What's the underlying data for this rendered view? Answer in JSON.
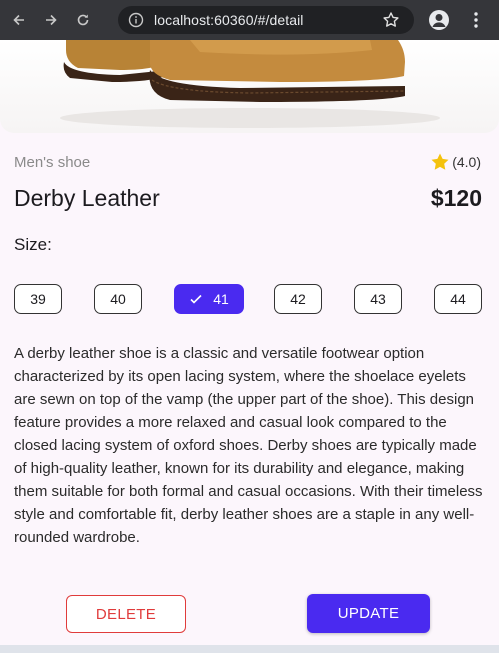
{
  "browser": {
    "url": "localhost:60360/#/detail",
    "icons": [
      "back-arrow-icon",
      "forward-arrow-icon",
      "reload-icon",
      "site-info-icon",
      "bookmark-star-icon",
      "profile-icon",
      "menu-dots-icon"
    ]
  },
  "product": {
    "category": "Men's shoe",
    "rating": "(4.0)",
    "name": "Derby Leather",
    "price": "$120",
    "size_label": "Size:",
    "sizes": [
      "39",
      "40",
      "41",
      "42",
      "43",
      "44"
    ],
    "selected_size": "41",
    "description": "A derby leather shoe is a classic and versatile footwear option characterized by its open lacing system, where the shoelace eyelets are sewn on top of the vamp (the upper part of the shoe). This design feature provides a more relaxed and casual look compared to the closed lacing system of oxford shoes. Derby shoes are typically made of high-quality leather, known for its durability and elegance, making them suitable for both formal and casual occasions. With their timeless style and comfortable fit, derby leather shoes are a staple in any well-rounded wardrobe."
  },
  "actions": {
    "delete_label": "DELETE",
    "update_label": "UPDATE"
  },
  "colors": {
    "accent": "#4a2af0",
    "danger": "#e03b3b",
    "star": "#f4c20d"
  }
}
